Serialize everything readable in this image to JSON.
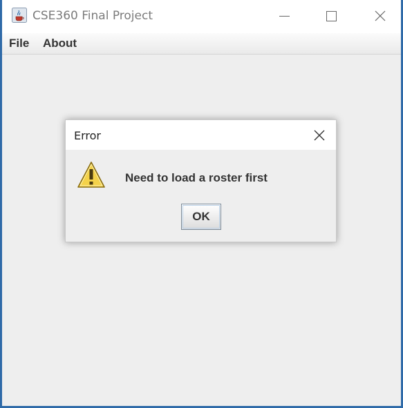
{
  "window": {
    "title": "CSE360 Final Project",
    "icon": "java-coffee-icon"
  },
  "menubar": {
    "items": [
      {
        "label": "File"
      },
      {
        "label": "About"
      }
    ]
  },
  "dialog": {
    "title": "Error",
    "message": "Need to load a roster first",
    "icon": "warning-icon",
    "ok_label": "OK"
  },
  "colors": {
    "window_border": "#2f6aa8",
    "panel_background": "#eeeeee",
    "warning_yellow": "#f4d24a"
  }
}
